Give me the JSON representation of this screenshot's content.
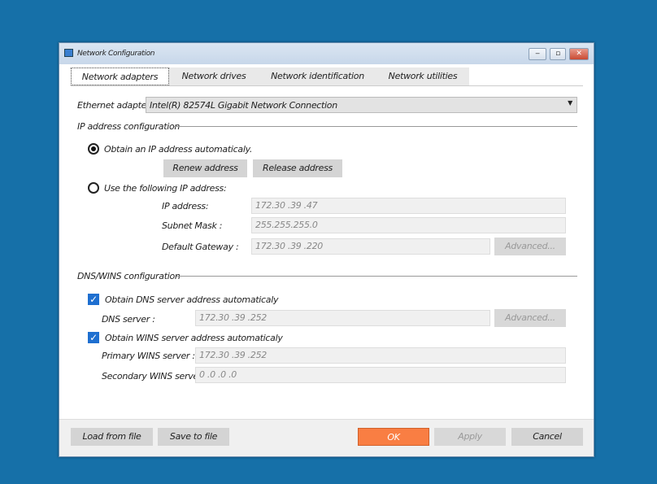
{
  "window": {
    "title": "Network Configuration",
    "min": "‒",
    "max": "▫",
    "close": "✕"
  },
  "tabs": [
    "Network adapters",
    "Network drives",
    "Network identification",
    "Network utilities"
  ],
  "adapter": {
    "label": "Ethernet adapter:",
    "value": "Intel(R) 82574L Gigabit Network Connection"
  },
  "ip": {
    "section": "IP address configuration",
    "auto_label": "Obtain an IP address automaticaly.",
    "renew": "Renew address",
    "release": "Release address",
    "manual_label": "Use the following IP address:",
    "ip_label": "IP address:",
    "ip_value": "172.30 .39 .47",
    "mask_label": "Subnet Mask :",
    "mask_value": "255.255.255.0",
    "gw_label": "Default Gateway :",
    "gw_value": "172.30 .39 .220",
    "advanced": "Advanced..."
  },
  "dns": {
    "section": "DNS/WINS configuration",
    "dns_auto": "Obtain DNS server address automaticaly",
    "dns_label": "DNS server :",
    "dns_value": "172.30 .39 .252",
    "advanced": "Advanced...",
    "wins_auto": "Obtain WINS server address automaticaly",
    "primary_label": "Primary WINS server :",
    "primary_value": "172.30 .39 .252",
    "secondary_label": "Secondary WINS server:",
    "secondary_value": "0  .0  .0  .0"
  },
  "footer": {
    "load": "Load from file",
    "save": "Save to file",
    "ok": "OK",
    "apply": "Apply",
    "cancel": "Cancel"
  },
  "colors": {
    "ok": "#f97e43",
    "check": "#1e6fd0"
  }
}
